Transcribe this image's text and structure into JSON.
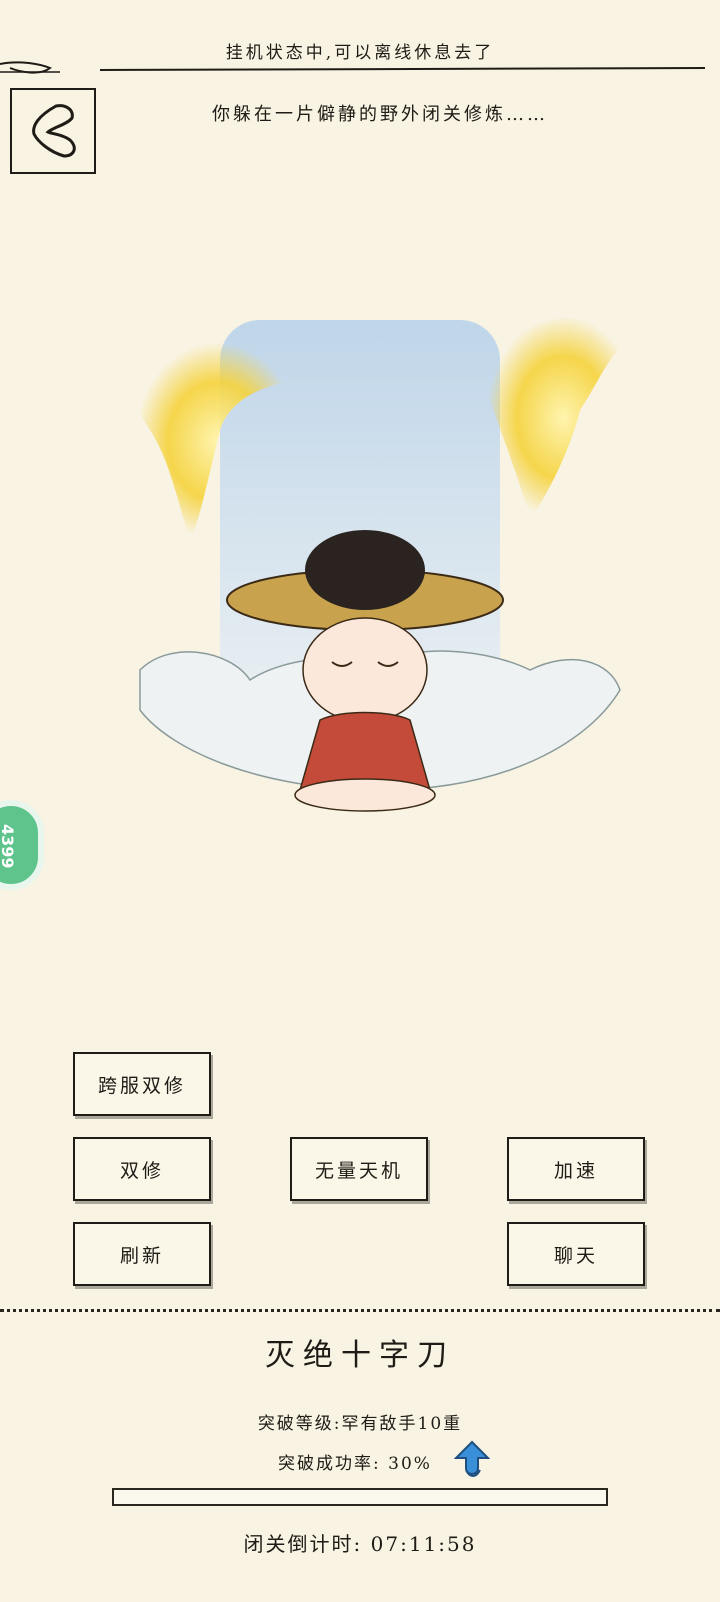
{
  "status_bar": {
    "idle_notice": "挂机状态中,可以离线休息去了"
  },
  "narration": "你躲在一片僻静的野外闭关修炼……",
  "side_tab": {
    "label": "4399"
  },
  "buttons": {
    "cross_server_dual": "跨服双修",
    "dual_cultivation": "双修",
    "infinite_heaven": "无量天机",
    "accelerate": "加速",
    "refresh": "刷新",
    "chat": "聊天"
  },
  "skill": {
    "name": "灭绝十字刀",
    "breakthrough_level": "突破等级:罕有敌手10重",
    "breakthrough_rate": "突破成功率: 30%",
    "progress": 0.0,
    "countdown": "闭关倒计时: 07:11:58"
  },
  "colors": {
    "paper": "#f8f3e2",
    "ink": "#1f1b16",
    "tab_green": "#5fc48c",
    "arrow_blue": "#3a8fd9",
    "spirit_gold": "#f5d23a"
  },
  "icons": {
    "back": "back-arrow-icon",
    "rate_up": "up-arrow-icon"
  }
}
